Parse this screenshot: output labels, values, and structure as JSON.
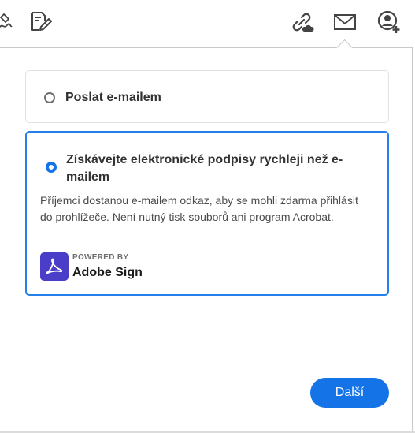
{
  "toolbar": {
    "icons": [
      "sign-icon",
      "edit-document-icon",
      "link-cloud-icon",
      "email-icon",
      "add-user-icon"
    ]
  },
  "options": {
    "email": {
      "label": "Poslat e-mailem",
      "selected": false
    },
    "sign": {
      "label": "Získávejte elektronické podpisy rychleji než e-mailem",
      "description": "Příjemci dostanou e-mailem odkaz, aby se mohli zdarma přihlásit do prohlížeče. Není nutný tisk souborů ani program Acrobat.",
      "selected": true,
      "powered_by": "POWERED BY",
      "brand": "Adobe Sign"
    }
  },
  "next_button": {
    "label": "Další"
  },
  "colors": {
    "accent": "#1473e6",
    "border_selected": "#2680eb",
    "adobe_sign_logo": "#4a3ec8"
  }
}
